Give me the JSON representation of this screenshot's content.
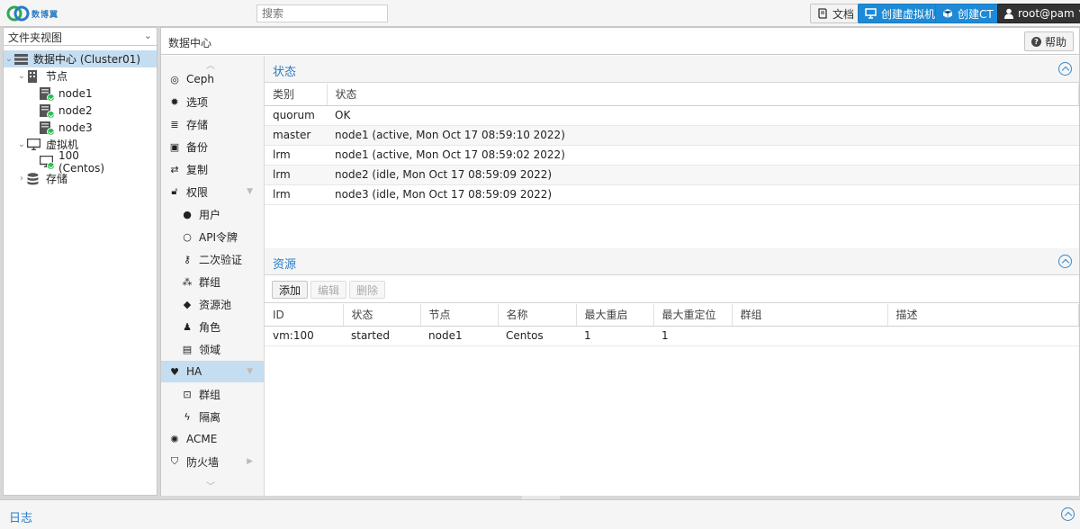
{
  "header": {
    "logo_text": "数博翼",
    "search_placeholder": "搜索",
    "docs_label": "文档",
    "create_vm_label": "创建虚拟机",
    "create_ct_label": "创建CT",
    "user_label": "root@pam"
  },
  "tree": {
    "view_label": "文件夹视图",
    "datacenter": "数据中心 (Cluster01)",
    "nodes_label": "节点",
    "nodes": [
      "node1",
      "node2",
      "node3"
    ],
    "vms_label": "虚拟机",
    "vm": "100 (Centos)",
    "storage_label": "存储"
  },
  "main": {
    "title": "数据中心",
    "help_label": "帮助"
  },
  "nav": {
    "items": [
      {
        "label": "Ceph",
        "icon": "ceph-icon"
      },
      {
        "label": "选项",
        "icon": "gear-icon"
      },
      {
        "label": "存储",
        "icon": "database-icon"
      },
      {
        "label": "备份",
        "icon": "floppy-icon"
      },
      {
        "label": "复制",
        "icon": "retweet-icon"
      },
      {
        "label": "权限",
        "icon": "unlock-icon"
      },
      {
        "label": "用户",
        "icon": "user-icon"
      },
      {
        "label": "API令牌",
        "icon": "user-outline-icon"
      },
      {
        "label": "二次验证",
        "icon": "key-icon"
      },
      {
        "label": "群组",
        "icon": "users-icon"
      },
      {
        "label": "资源池",
        "icon": "tags-icon"
      },
      {
        "label": "角色",
        "icon": "male-icon"
      },
      {
        "label": "领域",
        "icon": "address-book-icon"
      },
      {
        "label": "HA",
        "icon": "heartbeat-icon"
      },
      {
        "label": "群组",
        "icon": "object-group-icon"
      },
      {
        "label": "隔离",
        "icon": "bolt-icon"
      },
      {
        "label": "ACME",
        "icon": "certificate-icon"
      },
      {
        "label": "防火墙",
        "icon": "shield-icon"
      }
    ]
  },
  "status": {
    "title": "状态",
    "columns": [
      "类别",
      "状态"
    ],
    "rows": [
      [
        "quorum",
        "OK"
      ],
      [
        "master",
        "node1 (active, Mon Oct 17 08:59:10 2022)"
      ],
      [
        "lrm",
        "node1 (active, Mon Oct 17 08:59:02 2022)"
      ],
      [
        "lrm",
        "node2 (idle, Mon Oct 17 08:59:09 2022)"
      ],
      [
        "lrm",
        "node3 (idle, Mon Oct 17 08:59:09 2022)"
      ]
    ]
  },
  "resources": {
    "title": "资源",
    "add_label": "添加",
    "edit_label": "编辑",
    "delete_label": "删除",
    "columns": [
      "ID",
      "状态",
      "节点",
      "名称",
      "最大重启",
      "最大重定位",
      "群组",
      "描述"
    ],
    "rows": [
      [
        "vm:100",
        "started",
        "node1",
        "Centos",
        "1",
        "1",
        "",
        ""
      ]
    ]
  },
  "log": {
    "title": "日志"
  }
}
